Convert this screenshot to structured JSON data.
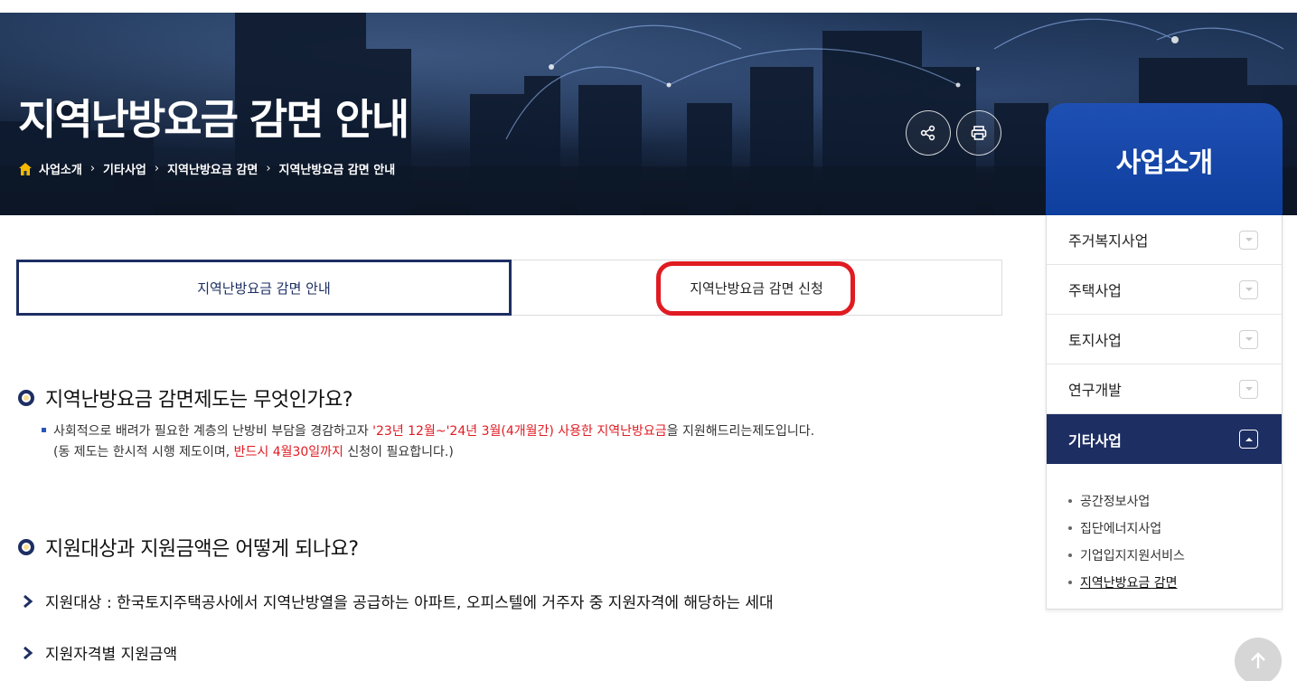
{
  "hero": {
    "title": "지역난방요금 감면 안내",
    "breadcrumb": [
      "사업소개",
      "기타사업",
      "지역난방요금 감면",
      "지역난방요금 감면 안내"
    ],
    "share_icon": "share-icon",
    "print_icon": "print-icon"
  },
  "tabs": [
    {
      "label": "지역난방요금 감면 안내",
      "active": true
    },
    {
      "label": "지역난방요금 감면 신청",
      "active": false
    }
  ],
  "sidebar": {
    "title": "사업소개",
    "items": [
      {
        "label": "주거복지사업"
      },
      {
        "label": "주택사업"
      },
      {
        "label": "토지사업"
      },
      {
        "label": "연구개발"
      },
      {
        "label": "기타사업",
        "active": true
      }
    ],
    "subitems": [
      "공간정보사업",
      "집단에너지사업",
      "기업입지지원서비스",
      "지역난방요금 감면"
    ]
  },
  "section1": {
    "title": "지역난방요금 감면제도는 무엇인가요?",
    "line1_a": "사회적으로 배려가 필요한 계층의 난방비 부담을 경감하고자 ",
    "line1_red": "'23년 12월~'24년 3월(4개월간) 사용한 지역난방요금",
    "line1_b": "을 지원해드리는제도입니다.",
    "line2_a": "(동 제도는 한시적 시행 제도이며, ",
    "line2_red": "반드시 4월30일까지",
    "line2_b": " 신청이 필요합니다.)"
  },
  "section2": {
    "title": "지원대상과 지원금액은 어떻게 되나요?",
    "item1": "지원대상 : 한국토지주택공사에서 지역난방열을 공급하는 아파트, 오피스텔에 거주자 중 지원자격에 해당하는 세대",
    "item2": "지원자격별 지원금액"
  },
  "colors": {
    "navy": "#1d2e63",
    "accent_red": "#e01b22",
    "sidebar_blue": "#1e4fb3"
  },
  "top_button_icon": "arrow-up-icon"
}
